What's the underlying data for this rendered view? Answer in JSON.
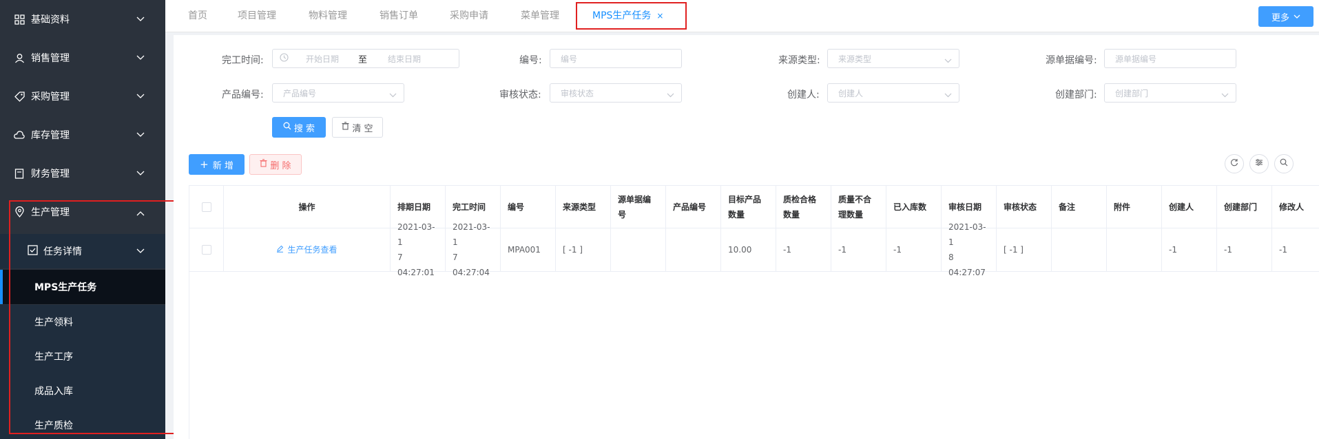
{
  "sidebar": {
    "items": [
      {
        "label": "基础资料"
      },
      {
        "label": "销售管理"
      },
      {
        "label": "采购管理"
      },
      {
        "label": "库存管理"
      },
      {
        "label": "财务管理"
      },
      {
        "label": "生产管理"
      }
    ],
    "group": {
      "label": "任务详情"
    },
    "subitems": [
      {
        "label": "MPS生产任务"
      },
      {
        "label": "生产领料"
      },
      {
        "label": "生产工序"
      },
      {
        "label": "成品入库"
      },
      {
        "label": "生产质检"
      }
    ]
  },
  "tabs": [
    {
      "label": "首页"
    },
    {
      "label": "项目管理"
    },
    {
      "label": "物料管理"
    },
    {
      "label": "销售订单"
    },
    {
      "label": "采购申请"
    },
    {
      "label": "菜单管理"
    },
    {
      "label": "MPS生产任务",
      "close": "×"
    }
  ],
  "more_button": "更多",
  "filters": {
    "finish_time": {
      "label": "完工时间:",
      "start_placeholder": "开始日期",
      "separator": "至",
      "end_placeholder": "结束日期"
    },
    "code": {
      "label": "编号:",
      "placeholder": "编号"
    },
    "source_type": {
      "label": "来源类型:",
      "placeholder": "来源类型"
    },
    "source_code": {
      "label": "源单据编号:",
      "placeholder": "源单据编号"
    },
    "product_code": {
      "label": "产品编号:",
      "placeholder": "产品编号"
    },
    "audit_status": {
      "label": "审核状态:",
      "placeholder": "审核状态"
    },
    "creator": {
      "label": "创建人:",
      "placeholder": "创建人"
    },
    "dept": {
      "label": "创建部门:",
      "placeholder": "创建部门"
    }
  },
  "buttons": {
    "search": "搜 索",
    "clear": "清 空",
    "add": "新 增",
    "delete": "删 除"
  },
  "colors": {
    "primary": "#409eff",
    "danger": "#f56c6c",
    "sidebar_bg": "#2b323c",
    "highlight": "#e02020"
  },
  "table": {
    "headers": [
      {
        "h1": "",
        "h2": ""
      },
      {
        "h1": "操作",
        "h2": ""
      },
      {
        "h1": "排期日期",
        "h2": ""
      },
      {
        "h1": "完工时间",
        "h2": ""
      },
      {
        "h1": "编号",
        "h2": ""
      },
      {
        "h1": "来源类型",
        "h2": ""
      },
      {
        "h1": "源单据编",
        "h2": "号"
      },
      {
        "h1": "产品编号",
        "h2": ""
      },
      {
        "h1": "目标产品",
        "h2": "数量"
      },
      {
        "h1": "质检合格",
        "h2": "数量"
      },
      {
        "h1": "质量不合",
        "h2": "理数量"
      },
      {
        "h1": "已入库数",
        "h2": ""
      },
      {
        "h1": "审核日期",
        "h2": ""
      },
      {
        "h1": "审核状态",
        "h2": ""
      },
      {
        "h1": "备注",
        "h2": ""
      },
      {
        "h1": "附件",
        "h2": ""
      },
      {
        "h1": "创建人",
        "h2": ""
      },
      {
        "h1": "创建部门",
        "h2": ""
      },
      {
        "h1": "修改人",
        "h2": ""
      }
    ],
    "rows": [
      {
        "cells": [
          {
            "l1": "",
            "l2": ""
          },
          {
            "l1": "生产任务查看",
            "l2": ""
          },
          {
            "l1": "2021-03-1",
            "l2": "7 04:27:01"
          },
          {
            "l1": "2021-03-1",
            "l2": "7 04:27:04"
          },
          {
            "l1": "MPA001",
            "l2": ""
          },
          {
            "l1": "[ -1 ]",
            "l2": ""
          },
          {
            "l1": "",
            "l2": ""
          },
          {
            "l1": "",
            "l2": ""
          },
          {
            "l1": "10.00",
            "l2": ""
          },
          {
            "l1": "-1",
            "l2": ""
          },
          {
            "l1": "-1",
            "l2": ""
          },
          {
            "l1": "-1",
            "l2": ""
          },
          {
            "l1": "2021-03-1",
            "l2": "8 04:27:07"
          },
          {
            "l1": "[ -1 ]",
            "l2": ""
          },
          {
            "l1": "",
            "l2": ""
          },
          {
            "l1": "",
            "l2": ""
          },
          {
            "l1": "-1",
            "l2": ""
          },
          {
            "l1": "-1",
            "l2": ""
          },
          {
            "l1": "-1",
            "l2": ""
          }
        ]
      }
    ]
  }
}
